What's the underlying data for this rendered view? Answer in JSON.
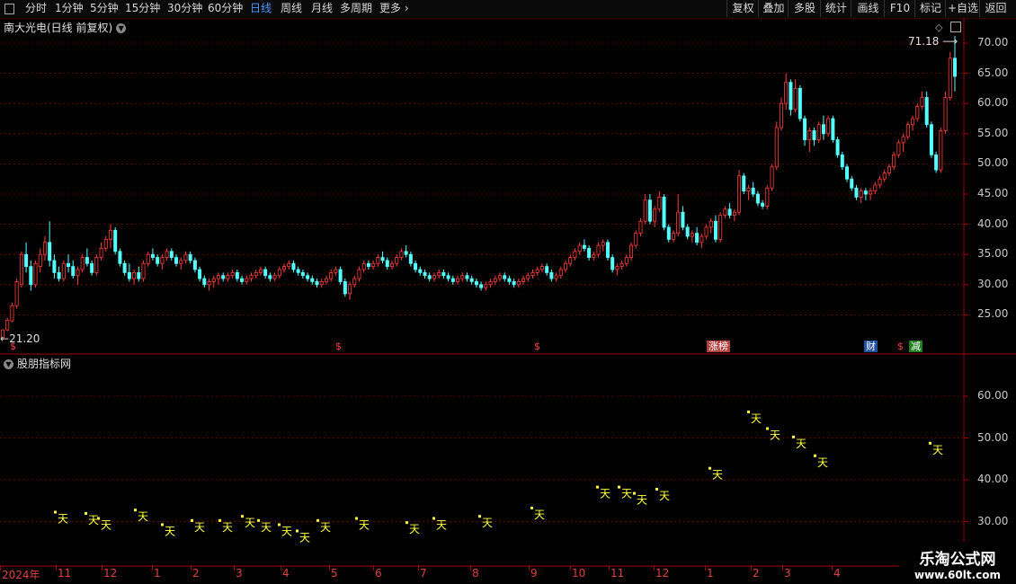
{
  "toolbar": {
    "left_items": [
      {
        "label": "分时",
        "active": false
      },
      {
        "label": "1分钟",
        "active": false
      },
      {
        "label": "5分钟",
        "active": false
      },
      {
        "label": "15分钟",
        "active": false
      },
      {
        "label": "30分钟",
        "active": false
      },
      {
        "label": "60分钟",
        "active": false
      },
      {
        "label": "日线",
        "active": true
      },
      {
        "label": "周线",
        "active": false
      },
      {
        "label": "月线",
        "active": false
      },
      {
        "label": "多周期",
        "active": false
      },
      {
        "label": "更多",
        "active": false
      }
    ],
    "right_items": [
      "复权",
      "叠加",
      "多股",
      "统计",
      "画线",
      "F10",
      "标记",
      "+自选",
      "返回"
    ]
  },
  "stock": {
    "title": "南大光电(日线 前复权)"
  },
  "indicator": {
    "title": "股朋指标网"
  },
  "price_axis": [
    "70.00",
    "65.00",
    "60.00",
    "55.00",
    "50.00",
    "45.00",
    "40.00",
    "35.00",
    "30.00",
    "25.00"
  ],
  "indicator_axis": [
    "60.00",
    "50.00",
    "40.00",
    "30.00"
  ],
  "annotations": {
    "high_label": "71.18",
    "low_label": "21.20"
  },
  "event_tags": [
    {
      "text": "$",
      "color": "#ff4040"
    },
    {
      "text": "$",
      "color": "#ff4040"
    },
    {
      "text": "$",
      "color": "#ff4040"
    },
    {
      "text": "涨榜",
      "color": "#ffffff",
      "bg": "#b04040"
    },
    {
      "text": "财",
      "color": "#ffffff",
      "bg": "#2050a0"
    },
    {
      "text": "$",
      "color": "#ff4040"
    },
    {
      "text": "减",
      "color": "#ffffff",
      "bg": "#208020"
    }
  ],
  "date_axis": [
    "2024年",
    "11",
    "12",
    "1",
    "2",
    "3",
    "4",
    "5",
    "6",
    "7",
    "8",
    "9",
    "10",
    "11",
    "12",
    "1",
    "2",
    "3",
    "4"
  ],
  "signal_glyph": "天",
  "watermark": {
    "line1": "乐淘公式网",
    "line2": "www.60lt.com"
  },
  "colors": {
    "up": "#ff3c3c",
    "down": "#54ffff",
    "signal": "#ffff40",
    "grid": "#5a0000"
  },
  "chart_data": {
    "type": "candlestick",
    "ylim": [
      21,
      72
    ],
    "candles": [
      [
        21.2,
        22.5,
        21.2,
        22.5
      ],
      [
        22.5,
        24.5,
        22.3,
        24.1
      ],
      [
        24,
        27,
        23.8,
        26.5
      ],
      [
        26.5,
        31,
        26,
        30.5
      ],
      [
        30,
        35.5,
        29.5,
        35
      ],
      [
        35,
        37,
        32,
        33
      ],
      [
        33,
        34,
        29,
        30
      ],
      [
        30,
        34,
        29.5,
        33.5
      ],
      [
        33,
        36,
        32,
        35
      ],
      [
        35,
        38,
        34,
        37
      ],
      [
        37,
        40.5,
        33,
        34
      ],
      [
        34,
        35,
        31,
        32
      ],
      [
        32,
        33,
        30.5,
        31
      ],
      [
        31,
        34,
        30.5,
        33.5
      ],
      [
        33.5,
        35,
        32,
        33
      ],
      [
        33,
        34,
        31,
        31.5
      ],
      [
        31.5,
        33,
        30,
        32.5
      ],
      [
        32.5,
        35,
        32,
        34.5
      ],
      [
        34.5,
        36,
        33,
        33.5
      ],
      [
        33.5,
        34,
        31.5,
        32
      ],
      [
        32,
        35,
        31.5,
        34.5
      ],
      [
        34.5,
        37,
        34,
        36
      ],
      [
        36,
        38,
        35.5,
        37.5
      ],
      [
        37.5,
        40,
        36,
        39
      ],
      [
        39,
        39.5,
        35,
        35.5
      ],
      [
        35.5,
        36,
        33,
        33.5
      ],
      [
        33.5,
        34,
        31.5,
        32
      ],
      [
        32,
        33.5,
        30.5,
        31
      ],
      [
        31,
        32.5,
        30,
        32
      ],
      [
        32,
        33,
        30.5,
        31
      ],
      [
        31,
        34,
        30.5,
        33.5
      ],
      [
        33.5,
        35.5,
        33,
        35
      ],
      [
        35,
        36,
        34,
        34.5
      ],
      [
        34.5,
        35,
        33,
        33.5
      ],
      [
        33.5,
        35,
        32.5,
        34.5
      ],
      [
        34.5,
        36,
        34,
        35.5
      ],
      [
        35.5,
        36,
        34,
        34.5
      ],
      [
        34.5,
        35,
        33,
        33.5
      ],
      [
        33.5,
        34.5,
        32.5,
        34
      ],
      [
        34,
        35.5,
        33.5,
        35
      ],
      [
        35,
        35.5,
        33.5,
        34
      ],
      [
        34,
        34.5,
        32,
        32.5
      ],
      [
        32.5,
        33,
        30.5,
        31
      ],
      [
        31,
        31.5,
        29.5,
        30
      ],
      [
        30,
        31,
        29,
        30.5
      ],
      [
        30.5,
        31.5,
        29.5,
        31
      ],
      [
        31,
        32,
        30,
        31.5
      ],
      [
        31.5,
        32,
        30.5,
        31
      ],
      [
        31,
        32,
        30.5,
        31.5
      ],
      [
        31.5,
        32.5,
        31,
        32
      ],
      [
        32,
        32.5,
        30.5,
        31
      ],
      [
        31,
        31.5,
        30,
        30.5
      ],
      [
        30.5,
        31.5,
        30,
        31
      ],
      [
        31,
        32,
        30.5,
        31.5
      ],
      [
        31.5,
        32.5,
        31,
        32
      ],
      [
        32,
        33,
        31.5,
        32.5
      ],
      [
        32.5,
        33,
        31,
        31.5
      ],
      [
        31.5,
        32,
        30.5,
        31
      ],
      [
        31,
        32,
        30.5,
        31.5
      ],
      [
        31.5,
        33,
        31,
        32.5
      ],
      [
        32.5,
        33.5,
        32,
        33
      ],
      [
        33,
        34,
        32.5,
        33.5
      ],
      [
        33.5,
        34,
        32,
        32.5
      ],
      [
        32.5,
        33,
        31.5,
        32
      ],
      [
        32,
        32.5,
        31,
        31.5
      ],
      [
        31.5,
        32,
        30.5,
        31
      ],
      [
        31,
        31.5,
        30,
        30.5
      ],
      [
        30.5,
        31,
        29.5,
        30
      ],
      [
        30,
        31,
        29.5,
        30.5
      ],
      [
        30.5,
        31.5,
        30,
        31
      ],
      [
        31,
        32.5,
        30.5,
        32
      ],
      [
        32,
        33,
        31.5,
        32.5
      ],
      [
        32.5,
        33,
        30,
        30.5
      ],
      [
        30.5,
        31,
        28,
        28.5
      ],
      [
        28.5,
        30.5,
        27.5,
        30
      ],
      [
        30,
        31.5,
        29.5,
        31
      ],
      [
        31,
        33,
        30.5,
        32.5
      ],
      [
        32.5,
        34,
        32,
        33.5
      ],
      [
        33.5,
        34,
        32.5,
        33
      ],
      [
        33,
        34,
        32.5,
        33.5
      ],
      [
        33.5,
        35,
        33,
        34.5
      ],
      [
        34.5,
        35.5,
        33.5,
        34
      ],
      [
        34,
        34.5,
        32.5,
        33
      ],
      [
        33,
        34,
        32.5,
        33.5
      ],
      [
        33.5,
        35,
        33,
        34.5
      ],
      [
        34.5,
        36,
        34,
        35.5
      ],
      [
        35.5,
        36.5,
        34.5,
        35
      ],
      [
        35,
        35.5,
        33,
        33.5
      ],
      [
        33.5,
        34,
        32,
        32.5
      ],
      [
        32.5,
        33,
        31.5,
        32
      ],
      [
        32,
        32.5,
        31,
        31.5
      ],
      [
        31.5,
        32,
        30.5,
        31
      ],
      [
        31,
        32,
        30.5,
        31.5
      ],
      [
        31.5,
        32.5,
        31,
        32
      ],
      [
        32,
        32.5,
        31,
        31.5
      ],
      [
        31.5,
        32,
        30.5,
        31
      ],
      [
        31,
        31.5,
        30,
        30.5
      ],
      [
        30.5,
        31.5,
        30,
        31
      ],
      [
        31,
        32,
        30.5,
        31.5
      ],
      [
        31.5,
        32,
        30.5,
        31
      ],
      [
        31,
        31.5,
        30,
        30.5
      ],
      [
        30.5,
        31,
        29.5,
        30
      ],
      [
        30,
        30.5,
        29,
        29.5
      ],
      [
        29.5,
        30.5,
        29,
        30
      ],
      [
        30,
        31,
        29.5,
        30.5
      ],
      [
        30.5,
        31.5,
        30,
        31
      ],
      [
        31,
        32,
        30.5,
        31.5
      ],
      [
        31.5,
        32,
        30.5,
        31
      ],
      [
        31,
        31.5,
        30,
        30.5
      ],
      [
        30.5,
        31,
        29.5,
        30
      ],
      [
        30,
        31,
        29.5,
        30.5
      ],
      [
        30.5,
        31.5,
        30,
        31
      ],
      [
        31,
        32,
        30.5,
        31.5
      ],
      [
        31.5,
        32.5,
        31,
        32
      ],
      [
        32,
        33,
        31.5,
        32.5
      ],
      [
        32.5,
        33.5,
        32,
        33
      ],
      [
        33,
        33.5,
        31.5,
        32
      ],
      [
        32,
        32.5,
        30.5,
        31
      ],
      [
        31,
        32,
        30.5,
        31.5
      ],
      [
        31.5,
        33,
        31,
        32.5
      ],
      [
        32.5,
        34,
        32,
        33.5
      ],
      [
        33.5,
        35,
        33,
        34.5
      ],
      [
        34.5,
        36,
        34,
        35.5
      ],
      [
        35.5,
        37,
        35,
        36.5
      ],
      [
        36.5,
        37.5,
        35.5,
        36
      ],
      [
        36,
        36.5,
        34,
        34.5
      ],
      [
        34.5,
        35.5,
        34,
        35
      ],
      [
        35,
        37,
        34.5,
        36.5
      ],
      [
        36.5,
        37.5,
        35.5,
        37
      ],
      [
        37,
        37.5,
        34,
        34.5
      ],
      [
        34.5,
        35,
        32,
        32.5
      ],
      [
        32.5,
        33.5,
        31.5,
        33
      ],
      [
        33,
        34,
        32.5,
        33.5
      ],
      [
        33.5,
        35,
        33,
        34.5
      ],
      [
        34.5,
        37,
        34,
        36.5
      ],
      [
        36.5,
        39,
        36,
        38.5
      ],
      [
        38.5,
        41,
        38,
        40.5
      ],
      [
        40.5,
        45,
        40,
        44
      ],
      [
        44,
        45,
        40,
        40.5
      ],
      [
        40.5,
        43,
        39.5,
        42.5
      ],
      [
        42.5,
        45.5,
        42,
        44.5
      ],
      [
        44.5,
        45,
        39,
        39.5
      ],
      [
        39.5,
        40,
        37,
        37.5
      ],
      [
        37.5,
        39,
        37,
        38.5
      ],
      [
        38.5,
        45,
        38,
        42
      ],
      [
        42,
        43,
        39,
        39.5
      ],
      [
        39.5,
        40,
        37.5,
        38
      ],
      [
        38,
        39,
        37,
        38.5
      ],
      [
        38.5,
        39.5,
        36.5,
        37
      ],
      [
        37,
        38.5,
        36,
        38
      ],
      [
        38,
        40,
        37.5,
        39.5
      ],
      [
        39.5,
        41,
        38.5,
        40.5
      ],
      [
        40.5,
        41.5,
        37,
        37.5
      ],
      [
        37.5,
        42,
        37,
        41.5
      ],
      [
        41.5,
        43,
        41,
        42.5
      ],
      [
        42.5,
        43.5,
        41,
        41.5
      ],
      [
        41.5,
        42.5,
        40.5,
        42
      ],
      [
        42,
        49,
        41.5,
        48
      ],
      [
        48,
        48.5,
        45,
        45.5
      ],
      [
        45.5,
        46.5,
        44,
        46
      ],
      [
        46,
        47,
        44.5,
        45
      ],
      [
        45,
        45.5,
        43,
        43.5
      ],
      [
        43.5,
        44,
        42.5,
        43
      ],
      [
        43,
        46.5,
        42.5,
        46
      ],
      [
        46,
        50,
        45.5,
        49.5
      ],
      [
        49.5,
        57,
        49,
        56
      ],
      [
        56,
        61,
        55.5,
        60
      ],
      [
        60,
        65,
        59,
        63.5
      ],
      [
        63.5,
        64,
        58,
        59
      ],
      [
        59,
        64,
        58.5,
        62.5
      ],
      [
        62.5,
        63,
        57,
        57.5
      ],
      [
        57.5,
        58,
        53,
        54
      ],
      [
        54,
        56,
        52,
        55.5
      ],
      [
        55.5,
        56,
        53,
        54
      ],
      [
        54,
        57,
        53.5,
        56.5
      ],
      [
        56.5,
        58,
        54,
        55
      ],
      [
        55,
        58,
        54.5,
        57.5
      ],
      [
        57.5,
        58,
        53.5,
        54
      ],
      [
        54,
        54.5,
        51,
        51.5
      ],
      [
        51.5,
        52,
        49,
        49.5
      ],
      [
        49.5,
        50,
        47,
        47.5
      ],
      [
        47.5,
        48,
        45.5,
        46
      ],
      [
        46,
        46.5,
        44,
        44.5
      ],
      [
        44.5,
        46,
        43.5,
        45.5
      ],
      [
        45.5,
        46,
        44,
        45
      ],
      [
        45,
        46,
        44,
        45.5
      ],
      [
        45.5,
        47,
        45,
        46.5
      ],
      [
        46.5,
        48,
        46,
        47.5
      ],
      [
        47.5,
        49,
        47,
        48.5
      ],
      [
        48.5,
        50,
        48,
        49.5
      ],
      [
        49.5,
        52,
        49,
        51.5
      ],
      [
        51.5,
        54,
        51,
        53.5
      ],
      [
        53.5,
        55,
        52,
        54.5
      ],
      [
        54.5,
        57,
        54,
        56.5
      ],
      [
        56.5,
        58,
        55.5,
        57.5
      ],
      [
        57.5,
        60,
        57,
        59.5
      ],
      [
        59.5,
        62,
        59,
        61
      ],
      [
        61,
        62,
        56,
        56.5
      ],
      [
        56.5,
        57,
        51,
        51.5
      ],
      [
        51.5,
        52,
        48.5,
        49
      ],
      [
        49,
        56,
        48.5,
        55.5
      ],
      [
        55.5,
        62,
        55,
        61
      ],
      [
        61,
        68.5,
        60.5,
        67.5
      ],
      [
        67.5,
        71.2,
        62,
        64.5
      ]
    ],
    "signals": [
      {
        "x": 62,
        "y": 31.5
      },
      {
        "x": 96,
        "y": 31.2
      },
      {
        "x": 110,
        "y": 30
      },
      {
        "x": 151,
        "y": 32
      },
      {
        "x": 181,
        "y": 28.5
      },
      {
        "x": 214,
        "y": 29.5
      },
      {
        "x": 245,
        "y": 29.5
      },
      {
        "x": 270,
        "y": 30.5
      },
      {
        "x": 288,
        "y": 29.5
      },
      {
        "x": 311,
        "y": 28.5
      },
      {
        "x": 331,
        "y": 27
      },
      {
        "x": 354,
        "y": 29.5
      },
      {
        "x": 397,
        "y": 30
      },
      {
        "x": 453,
        "y": 29
      },
      {
        "x": 483,
        "y": 30
      },
      {
        "x": 534,
        "y": 30.5
      },
      {
        "x": 592,
        "y": 32.5
      },
      {
        "x": 665,
        "y": 37.5
      },
      {
        "x": 689,
        "y": 37.5
      },
      {
        "x": 706,
        "y": 36
      },
      {
        "x": 731,
        "y": 37
      },
      {
        "x": 790,
        "y": 42
      },
      {
        "x": 833,
        "y": 55.5
      },
      {
        "x": 854,
        "y": 51.5
      },
      {
        "x": 883,
        "y": 49.5
      },
      {
        "x": 907,
        "y": 45
      },
      {
        "x": 1035,
        "y": 48
      }
    ],
    "indicator_ylim": [
      26,
      70
    ]
  }
}
